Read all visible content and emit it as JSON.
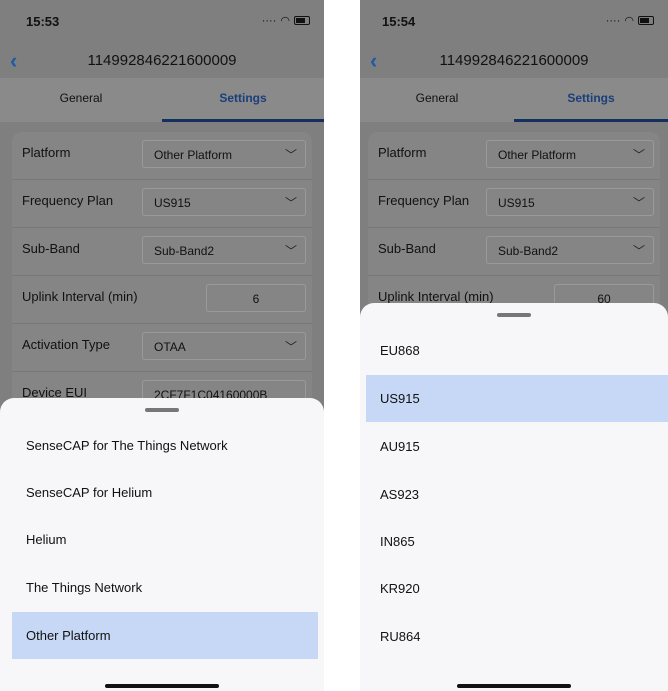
{
  "left": {
    "time": "15:53",
    "device_id": "114992846221600009",
    "tabs": [
      {
        "label": "General"
      },
      {
        "label": "Settings"
      }
    ],
    "rows": [
      {
        "label": "Platform",
        "value": "Other Platform"
      },
      {
        "label": "Frequency Plan",
        "value": "US915"
      },
      {
        "label": "Sub-Band",
        "value": "Sub-Band2"
      },
      {
        "label": "Uplink Interval (min)",
        "value": "6"
      },
      {
        "label": "Activation Type",
        "value": "OTAA"
      },
      {
        "label": "Device EUI",
        "value": "2CF7F1C04160000B"
      }
    ],
    "sheet_options": [
      {
        "label": "SenseCAP for The Things Network",
        "selected": false
      },
      {
        "label": "SenseCAP for Helium",
        "selected": false
      },
      {
        "label": "Helium",
        "selected": false
      },
      {
        "label": "The Things Network",
        "selected": false
      },
      {
        "label": "Other Platform",
        "selected": true
      }
    ]
  },
  "right": {
    "time": "15:54",
    "device_id": "114992846221600009",
    "tabs": [
      {
        "label": "General"
      },
      {
        "label": "Settings"
      }
    ],
    "rows": [
      {
        "label": "Platform",
        "value": "Other Platform"
      },
      {
        "label": "Frequency Plan",
        "value": "US915"
      },
      {
        "label": "Sub-Band",
        "value": "Sub-Band2"
      },
      {
        "label": "Uplink Interval (min)",
        "value": "60"
      }
    ],
    "sheet_options": [
      {
        "label": "EU868",
        "selected": false
      },
      {
        "label": "US915",
        "selected": true
      },
      {
        "label": "AU915",
        "selected": false
      },
      {
        "label": "AS923",
        "selected": false
      },
      {
        "label": "IN865",
        "selected": false
      },
      {
        "label": "KR920",
        "selected": false
      },
      {
        "label": "RU864",
        "selected": false
      }
    ]
  },
  "colors": {
    "accent": "#1e5aa8",
    "selected_bg": "#c6d8f5",
    "tab_underline": "#14305e"
  }
}
